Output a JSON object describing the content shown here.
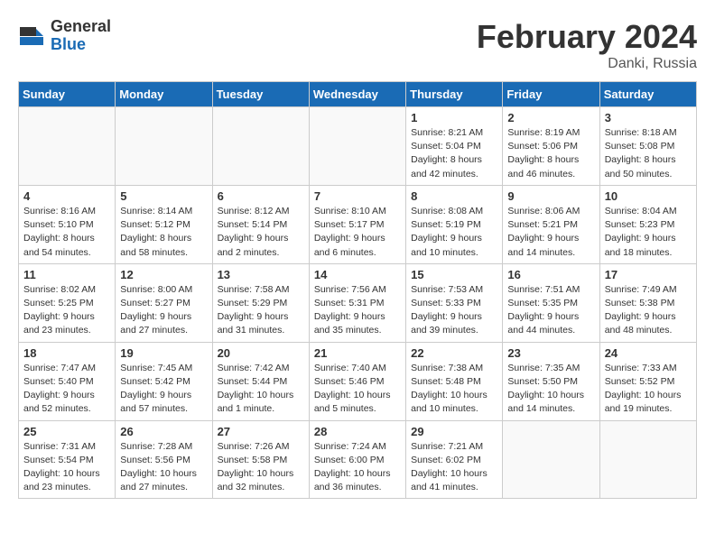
{
  "header": {
    "logo_general": "General",
    "logo_blue": "Blue",
    "title": "February 2024",
    "location": "Danki, Russia"
  },
  "weekdays": [
    "Sunday",
    "Monday",
    "Tuesday",
    "Wednesday",
    "Thursday",
    "Friday",
    "Saturday"
  ],
  "weeks": [
    [
      {
        "day": "",
        "info": ""
      },
      {
        "day": "",
        "info": ""
      },
      {
        "day": "",
        "info": ""
      },
      {
        "day": "",
        "info": ""
      },
      {
        "day": "1",
        "info": "Sunrise: 8:21 AM\nSunset: 5:04 PM\nDaylight: 8 hours\nand 42 minutes."
      },
      {
        "day": "2",
        "info": "Sunrise: 8:19 AM\nSunset: 5:06 PM\nDaylight: 8 hours\nand 46 minutes."
      },
      {
        "day": "3",
        "info": "Sunrise: 8:18 AM\nSunset: 5:08 PM\nDaylight: 8 hours\nand 50 minutes."
      }
    ],
    [
      {
        "day": "4",
        "info": "Sunrise: 8:16 AM\nSunset: 5:10 PM\nDaylight: 8 hours\nand 54 minutes."
      },
      {
        "day": "5",
        "info": "Sunrise: 8:14 AM\nSunset: 5:12 PM\nDaylight: 8 hours\nand 58 minutes."
      },
      {
        "day": "6",
        "info": "Sunrise: 8:12 AM\nSunset: 5:14 PM\nDaylight: 9 hours\nand 2 minutes."
      },
      {
        "day": "7",
        "info": "Sunrise: 8:10 AM\nSunset: 5:17 PM\nDaylight: 9 hours\nand 6 minutes."
      },
      {
        "day": "8",
        "info": "Sunrise: 8:08 AM\nSunset: 5:19 PM\nDaylight: 9 hours\nand 10 minutes."
      },
      {
        "day": "9",
        "info": "Sunrise: 8:06 AM\nSunset: 5:21 PM\nDaylight: 9 hours\nand 14 minutes."
      },
      {
        "day": "10",
        "info": "Sunrise: 8:04 AM\nSunset: 5:23 PM\nDaylight: 9 hours\nand 18 minutes."
      }
    ],
    [
      {
        "day": "11",
        "info": "Sunrise: 8:02 AM\nSunset: 5:25 PM\nDaylight: 9 hours\nand 23 minutes."
      },
      {
        "day": "12",
        "info": "Sunrise: 8:00 AM\nSunset: 5:27 PM\nDaylight: 9 hours\nand 27 minutes."
      },
      {
        "day": "13",
        "info": "Sunrise: 7:58 AM\nSunset: 5:29 PM\nDaylight: 9 hours\nand 31 minutes."
      },
      {
        "day": "14",
        "info": "Sunrise: 7:56 AM\nSunset: 5:31 PM\nDaylight: 9 hours\nand 35 minutes."
      },
      {
        "day": "15",
        "info": "Sunrise: 7:53 AM\nSunset: 5:33 PM\nDaylight: 9 hours\nand 39 minutes."
      },
      {
        "day": "16",
        "info": "Sunrise: 7:51 AM\nSunset: 5:35 PM\nDaylight: 9 hours\nand 44 minutes."
      },
      {
        "day": "17",
        "info": "Sunrise: 7:49 AM\nSunset: 5:38 PM\nDaylight: 9 hours\nand 48 minutes."
      }
    ],
    [
      {
        "day": "18",
        "info": "Sunrise: 7:47 AM\nSunset: 5:40 PM\nDaylight: 9 hours\nand 52 minutes."
      },
      {
        "day": "19",
        "info": "Sunrise: 7:45 AM\nSunset: 5:42 PM\nDaylight: 9 hours\nand 57 minutes."
      },
      {
        "day": "20",
        "info": "Sunrise: 7:42 AM\nSunset: 5:44 PM\nDaylight: 10 hours\nand 1 minute."
      },
      {
        "day": "21",
        "info": "Sunrise: 7:40 AM\nSunset: 5:46 PM\nDaylight: 10 hours\nand 5 minutes."
      },
      {
        "day": "22",
        "info": "Sunrise: 7:38 AM\nSunset: 5:48 PM\nDaylight: 10 hours\nand 10 minutes."
      },
      {
        "day": "23",
        "info": "Sunrise: 7:35 AM\nSunset: 5:50 PM\nDaylight: 10 hours\nand 14 minutes."
      },
      {
        "day": "24",
        "info": "Sunrise: 7:33 AM\nSunset: 5:52 PM\nDaylight: 10 hours\nand 19 minutes."
      }
    ],
    [
      {
        "day": "25",
        "info": "Sunrise: 7:31 AM\nSunset: 5:54 PM\nDaylight: 10 hours\nand 23 minutes."
      },
      {
        "day": "26",
        "info": "Sunrise: 7:28 AM\nSunset: 5:56 PM\nDaylight: 10 hours\nand 27 minutes."
      },
      {
        "day": "27",
        "info": "Sunrise: 7:26 AM\nSunset: 5:58 PM\nDaylight: 10 hours\nand 32 minutes."
      },
      {
        "day": "28",
        "info": "Sunrise: 7:24 AM\nSunset: 6:00 PM\nDaylight: 10 hours\nand 36 minutes."
      },
      {
        "day": "29",
        "info": "Sunrise: 7:21 AM\nSunset: 6:02 PM\nDaylight: 10 hours\nand 41 minutes."
      },
      {
        "day": "",
        "info": ""
      },
      {
        "day": "",
        "info": ""
      }
    ]
  ]
}
